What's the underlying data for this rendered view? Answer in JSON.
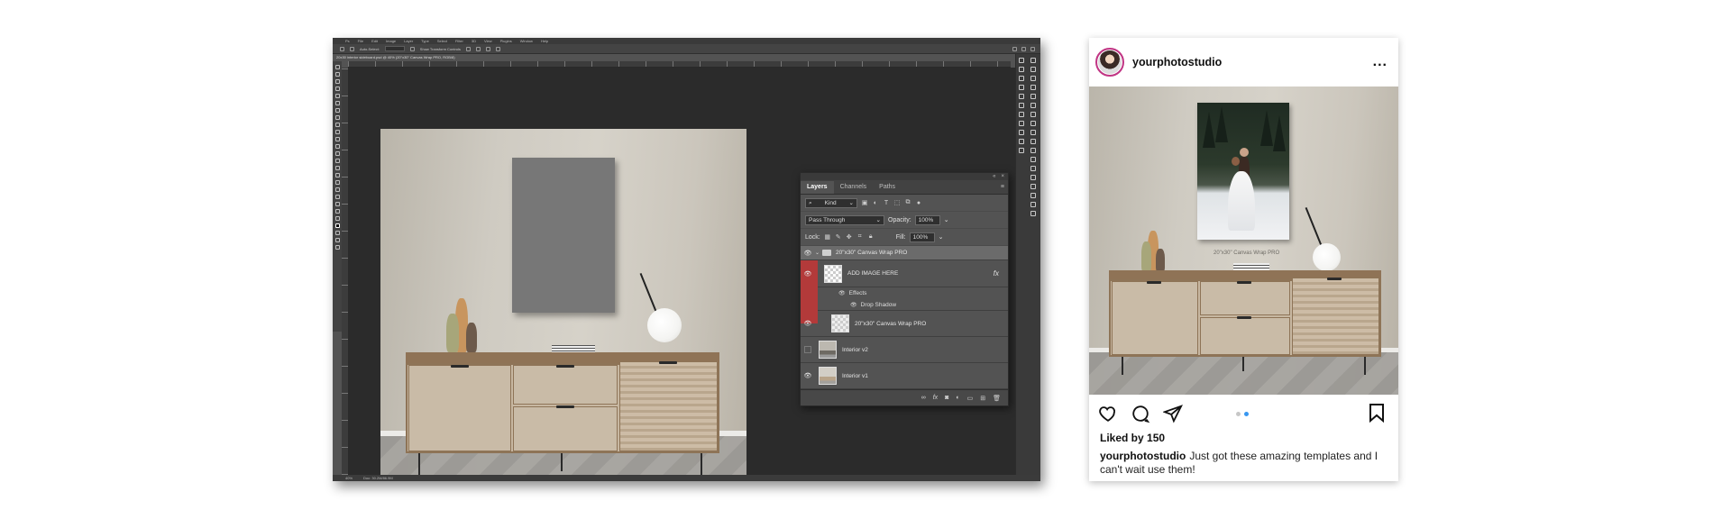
{
  "photoshop": {
    "menu": [
      "Ps",
      "File",
      "Edit",
      "Image",
      "Layer",
      "Type",
      "Select",
      "Filter",
      "3D",
      "View",
      "Plugins",
      "Window",
      "Help"
    ],
    "options_label": "Auto-Select:",
    "options_value": "Layer",
    "show_transform": "Show Transform Controls",
    "doc_tab": "20x30 interior sideboard.psd @ 40% (20\"x30\" Canvas Wrap PRO, RGB/8)",
    "status_zoom": "40%",
    "status_doc": "Doc: 30.2M/86.9M"
  },
  "layers_panel": {
    "tabs": [
      "Layers",
      "Channels",
      "Paths"
    ],
    "filter_kind": "Kind",
    "blend_mode": "Pass Through",
    "opacity_label": "Opacity:",
    "opacity_value": "100%",
    "lock_label": "Lock:",
    "fill_label": "Fill:",
    "fill_value": "100%",
    "group_name": "20\"x30\" Canvas Wrap PRO",
    "layers": [
      {
        "name": "ADD IMAGE HERE",
        "visible": true,
        "fx": "fx"
      },
      {
        "name": "20\"x30\" Canvas Wrap PRO",
        "visible": true
      },
      {
        "name": "Interior v2",
        "visible": false
      },
      {
        "name": "Interior v1",
        "visible": true
      }
    ],
    "effects_label": "Effects",
    "drop_shadow_label": "Drop Shadow",
    "bottom_icons": [
      "link-icon",
      "fx-icon",
      "mask-icon",
      "adjustment-icon",
      "folder-icon",
      "new-layer-icon",
      "trash-icon"
    ]
  },
  "instagram": {
    "username": "yourphotostudio",
    "more": "...",
    "image_caption": "20\"x30\" Canvas Wrap PRO",
    "likes": "Liked by 150",
    "caption_user": "yourphotostudio",
    "caption_text": "Just got these amazing templates and I can't wait use them!",
    "carousel_total": 2,
    "carousel_active": 2,
    "colors": {
      "accent_blue": "#3897f0",
      "avatar_ring": "#c13584"
    }
  }
}
